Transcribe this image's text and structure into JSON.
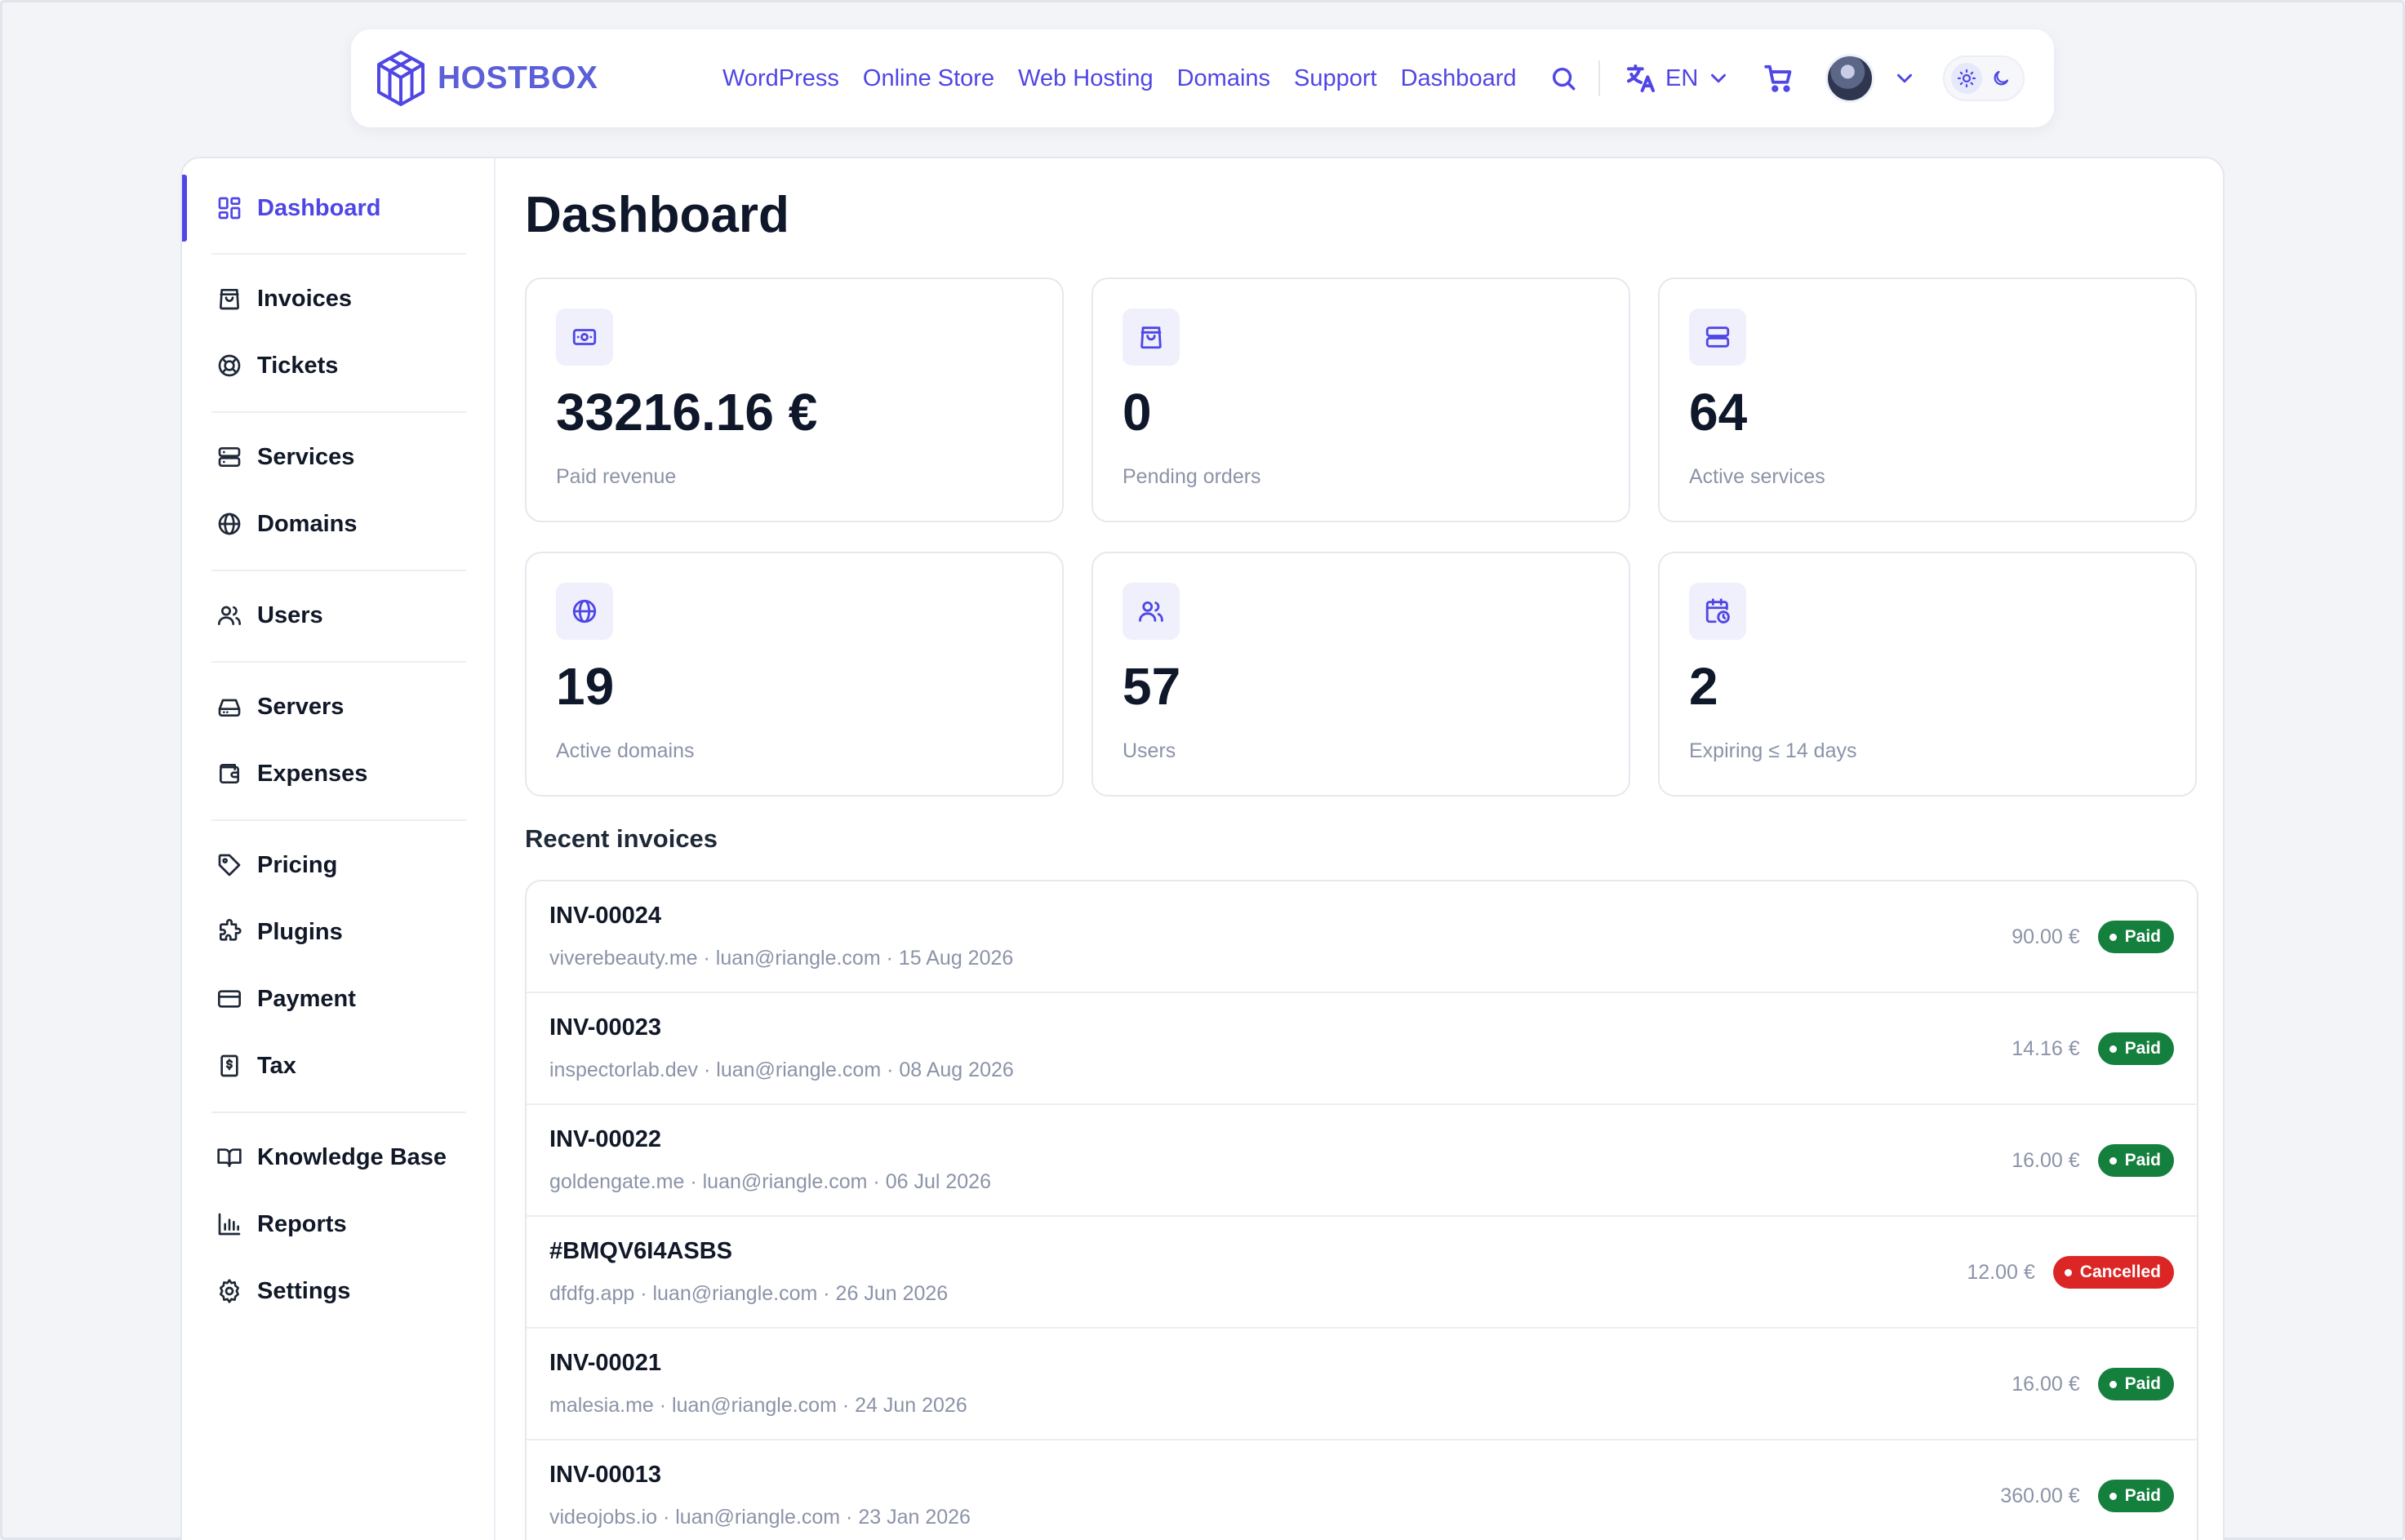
{
  "brand": {
    "name": "HOSTBOX"
  },
  "topnav": {
    "links": [
      "WordPress",
      "Online Store",
      "Web Hosting",
      "Domains",
      "Support",
      "Dashboard"
    ],
    "language": "EN"
  },
  "sidebar": {
    "items": [
      {
        "label": "Dashboard",
        "icon": "dashboard-grid-icon",
        "active": true
      },
      {
        "label": "Invoices",
        "icon": "shopping-bag-icon"
      },
      {
        "label": "Tickets",
        "icon": "lifebuoy-icon"
      },
      {
        "label": "Services",
        "icon": "server-stack-icon"
      },
      {
        "label": "Domains",
        "icon": "globe-icon"
      },
      {
        "label": "Users",
        "icon": "users-icon"
      },
      {
        "label": "Servers",
        "icon": "hard-drive-icon"
      },
      {
        "label": "Expenses",
        "icon": "wallet-icon"
      },
      {
        "label": "Pricing",
        "icon": "tag-icon"
      },
      {
        "label": "Plugins",
        "icon": "puzzle-icon"
      },
      {
        "label": "Payment",
        "icon": "credit-card-icon"
      },
      {
        "label": "Tax",
        "icon": "receipt-dollar-icon"
      },
      {
        "label": "Knowledge Base",
        "icon": "book-open-icon"
      },
      {
        "label": "Reports",
        "icon": "bar-chart-icon"
      },
      {
        "label": "Settings",
        "icon": "gear-icon"
      }
    ]
  },
  "main": {
    "title": "Dashboard",
    "stats": [
      {
        "value": "33216.16 €",
        "label": "Paid revenue",
        "icon": "banknote-icon"
      },
      {
        "value": "0",
        "label": "Pending orders",
        "icon": "shopping-bag-icon"
      },
      {
        "value": "64",
        "label": "Active services",
        "icon": "server-stack-icon"
      },
      {
        "value": "19",
        "label": "Active domains",
        "icon": "globe-icon"
      },
      {
        "value": "57",
        "label": "Users",
        "icon": "users-icon"
      },
      {
        "value": "2",
        "label": "Expiring ≤ 14 days",
        "icon": "calendar-clock-icon"
      }
    ],
    "recent_invoices_title": "Recent invoices",
    "invoices": [
      {
        "id": "INV-00024",
        "meta": "viverebeauty.me · luan@riangle.com · 15 Aug 2026",
        "amount": "90.00 €",
        "status": "Paid"
      },
      {
        "id": "INV-00023",
        "meta": "inspectorlab.dev · luan@riangle.com · 08 Aug 2026",
        "amount": "14.16 €",
        "status": "Paid"
      },
      {
        "id": "INV-00022",
        "meta": "goldengate.me · luan@riangle.com · 06 Jul 2026",
        "amount": "16.00 €",
        "status": "Paid"
      },
      {
        "id": "#BMQV6I4ASBS",
        "meta": "dfdfg.app · luan@riangle.com · 26 Jun 2026",
        "amount": "12.00 €",
        "status": "Cancelled"
      },
      {
        "id": "INV-00021",
        "meta": "malesia.me · luan@riangle.com · 24 Jun 2026",
        "amount": "16.00 €",
        "status": "Paid"
      },
      {
        "id": "INV-00013",
        "meta": "videojobs.io · luan@riangle.com · 23 Jan 2026",
        "amount": "360.00 €",
        "status": "Paid"
      }
    ]
  },
  "colors": {
    "accent": "#4f46e5",
    "paid": "#15803d",
    "cancelled": "#dc2626"
  }
}
